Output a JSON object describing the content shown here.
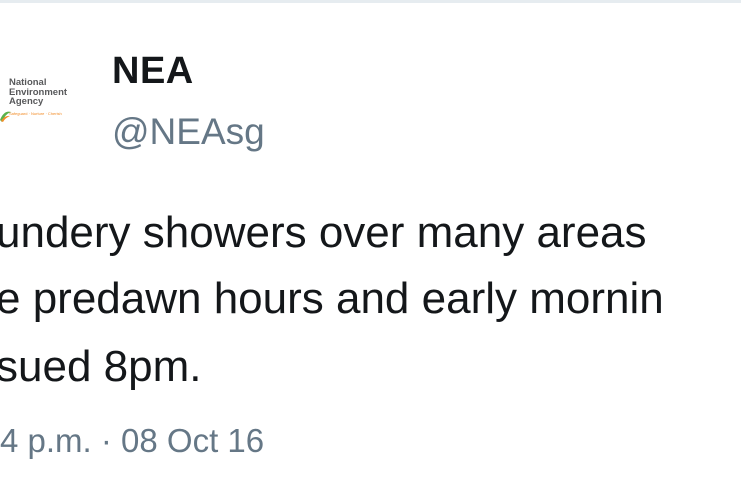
{
  "profile": {
    "avatar": {
      "logo_lines": [
        "National",
        "Environment",
        "Agency"
      ],
      "tagline": "Safeguard · Nurture · Cherish"
    },
    "display_name": "NEA",
    "handle": "@NEAsg"
  },
  "tweet": {
    "lines": [
      "undery showers over many areas",
      "e predawn hours and early mornin",
      "sued 8pm."
    ],
    "timestamp": "4 p.m. · 08 Oct 16"
  },
  "colors": {
    "text": "#14171a",
    "secondary_text": "#657786",
    "divider": "#e6ecf0",
    "logo_grey": "#58595b",
    "logo_orange": "#f28c28",
    "logo_green": "#5bb24a"
  }
}
